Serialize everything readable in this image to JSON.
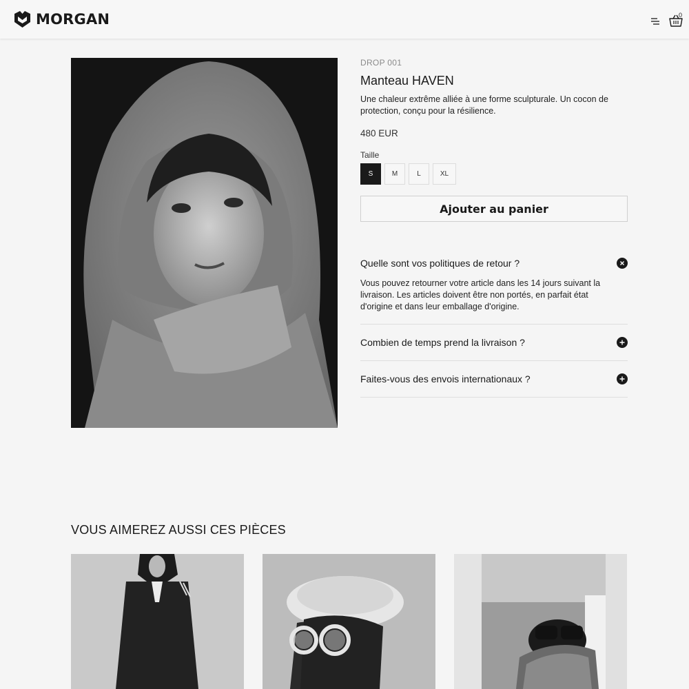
{
  "brand": {
    "name": "MORGAN"
  },
  "header": {
    "cart_count": "0",
    "menu_icon": "menu-icon",
    "cart_icon": "basket-icon"
  },
  "product": {
    "drop": "DROP 001",
    "title": "Manteau HAVEN",
    "description": "Une chaleur extrême alliée à une forme sculpturale. Un cocon de protection, conçu pour la résilience.",
    "price": "480 EUR",
    "size_label": "Taille",
    "sizes": [
      "S",
      "M",
      "L",
      "XL"
    ],
    "selected_size": "S",
    "add_to_cart": "Ajouter au panier"
  },
  "faq": [
    {
      "question": "Quelle sont vos politiques de retour ?",
      "answer": "Vous pouvez retourner votre article dans les 14 jours suivant la livraison. Les articles doivent être non portés, en parfait état d'origine et dans leur emballage d'origine.",
      "open": true
    },
    {
      "question": "Combien de temps prend la livraison ?",
      "open": false
    },
    {
      "question": "Faites-vous des envois internationaux ?",
      "open": false
    }
  ],
  "recommendations": {
    "title": "VOUS AIMEREZ AUSSI CES PIÈCES",
    "count": 3
  },
  "colors": {
    "background": "#f5f5f5",
    "text": "#1a1a1a",
    "accent": "#1a1a1a",
    "muted": "#8a8a8a",
    "divider": "#dedede"
  }
}
